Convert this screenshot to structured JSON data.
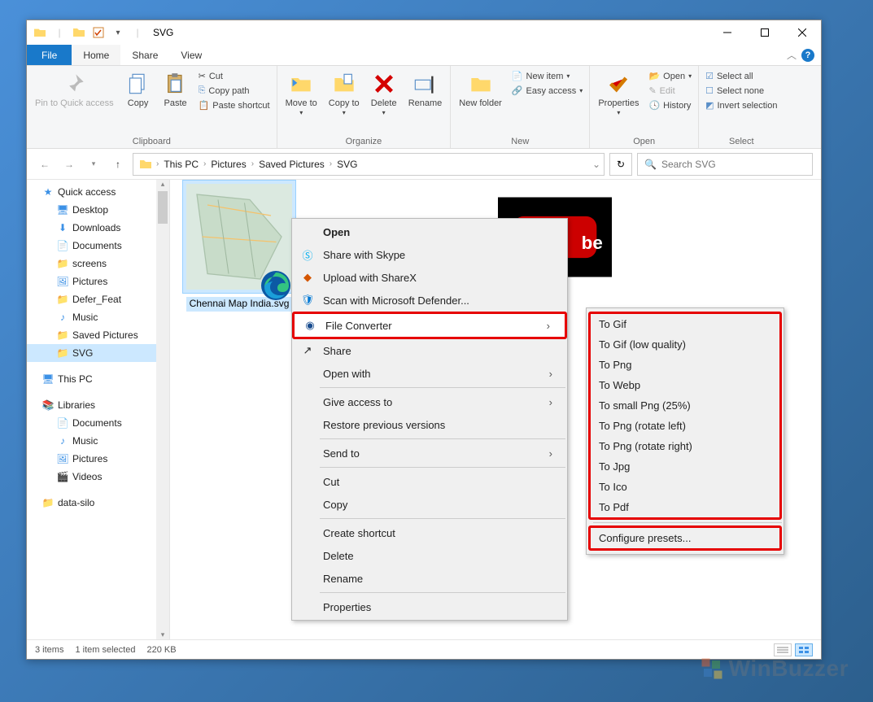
{
  "title": "SVG",
  "menubar": {
    "file": "File",
    "home": "Home",
    "share": "Share",
    "view": "View"
  },
  "ribbon": {
    "clipboard": {
      "label": "Clipboard",
      "pin": "Pin to Quick access",
      "copy": "Copy",
      "paste": "Paste",
      "cut": "Cut",
      "copypath": "Copy path",
      "pasteshortcut": "Paste shortcut"
    },
    "organize": {
      "label": "Organize",
      "moveto": "Move to",
      "copyto": "Copy to",
      "delete": "Delete",
      "rename": "Rename"
    },
    "new": {
      "label": "New",
      "newfolder": "New folder",
      "newitem": "New item",
      "easyaccess": "Easy access"
    },
    "open": {
      "label": "Open",
      "properties": "Properties",
      "open": "Open",
      "edit": "Edit",
      "history": "History"
    },
    "select": {
      "label": "Select",
      "selectall": "Select all",
      "selectnone": "Select none",
      "invert": "Invert selection"
    }
  },
  "breadcrumb": [
    "This PC",
    "Pictures",
    "Saved Pictures",
    "SVG"
  ],
  "search_placeholder": "Search SVG",
  "sidebar": {
    "quickaccess": "Quick access",
    "items": [
      {
        "label": "Desktop",
        "icon": "desktop",
        "pinned": true
      },
      {
        "label": "Downloads",
        "icon": "download",
        "pinned": true
      },
      {
        "label": "Documents",
        "icon": "document",
        "pinned": true
      },
      {
        "label": "screens",
        "icon": "folder",
        "pinned": true
      },
      {
        "label": "Pictures",
        "icon": "pictures",
        "pinned": true
      },
      {
        "label": "Defer_Feat",
        "icon": "folder",
        "pinned": false
      },
      {
        "label": "Music",
        "icon": "music",
        "pinned": false
      },
      {
        "label": "Saved Pictures",
        "icon": "folder",
        "pinned": false
      },
      {
        "label": "SVG",
        "icon": "folder",
        "pinned": false,
        "selected": true
      }
    ],
    "thispc": "This PC",
    "libraries": "Libraries",
    "lib_items": [
      {
        "label": "Documents",
        "icon": "document"
      },
      {
        "label": "Music",
        "icon": "music"
      },
      {
        "label": "Pictures",
        "icon": "pictures"
      },
      {
        "label": "Videos",
        "icon": "videos"
      }
    ],
    "last": "data-silo"
  },
  "files": [
    {
      "name": "Chennai Map India.svg",
      "selected": true,
      "thumb": "map"
    },
    {
      "name": "",
      "selected": false,
      "thumb": "youtube"
    }
  ],
  "status": {
    "count": "3 items",
    "sel": "1 item selected",
    "size": "220 KB"
  },
  "context": {
    "open": "Open",
    "skype": "Share with Skype",
    "sharex": "Upload with ShareX",
    "defender": "Scan with Microsoft Defender...",
    "fileconverter": "File Converter",
    "share": "Share",
    "openwith": "Open with",
    "giveaccess": "Give access to",
    "restore": "Restore previous versions",
    "sendto": "Send to",
    "cut": "Cut",
    "copy": "Copy",
    "shortcut": "Create shortcut",
    "delete": "Delete",
    "rename": "Rename",
    "properties": "Properties"
  },
  "submenu": {
    "items": [
      "To Gif",
      "To Gif (low quality)",
      "To Png",
      "To Webp",
      "To small Png (25%)",
      "To Png (rotate left)",
      "To Png (rotate right)",
      "To Jpg",
      "To Ico",
      "To Pdf"
    ],
    "configure": "Configure presets..."
  },
  "watermark": "WinBuzzer"
}
